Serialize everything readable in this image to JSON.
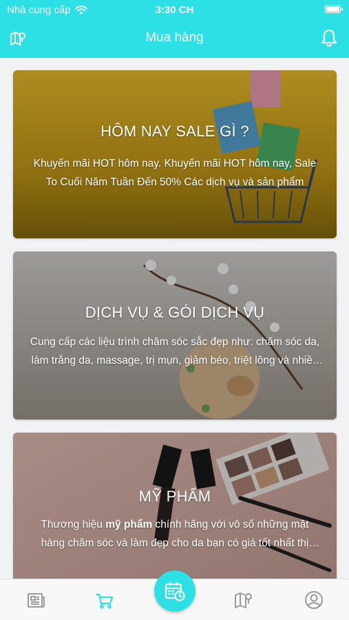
{
  "status_bar": {
    "carrier": "Nhà cung cấp",
    "time": "3:30 CH"
  },
  "header": {
    "title": "Mua hàng",
    "left_icon": "map-pin-icon",
    "right_icon": "bell-icon"
  },
  "cards": [
    {
      "title": "HÔM NAY SALE GÌ ?",
      "description": "Khuyến mãi HOT hôm nay. Khuyến mãi HOT hôm nay, Sale To Cuối Năm Tuần Đến 50% Các dịch vụ và sản phẩm"
    },
    {
      "title": "DỊCH VỤ & GÓI DỊCH VỤ",
      "description": "Cung cấp các liệu trình chăm sóc sắc đẹp như: chăm sóc da, làm trắng da, massage, trị mụn, giảm béo, triệt lông và nhiều dịch vụ khác"
    },
    {
      "title": "MỸ PHẨM",
      "description_prefix": "Thương hiệu ",
      "description_bold": "mỹ phẩm",
      "description_suffix": " chính hãng với vô số những mặt hàng chăm sóc và làm đẹp cho da bạn có giá tốt nhất thị trường"
    }
  ],
  "tabbar": {
    "items": [
      "news-icon",
      "cart-icon",
      "calendar-clock-icon",
      "map-icon",
      "profile-icon"
    ],
    "active": "cart-icon"
  },
  "colors": {
    "accent": "#2ce0e6",
    "tab_inactive": "#9a9a9a"
  }
}
